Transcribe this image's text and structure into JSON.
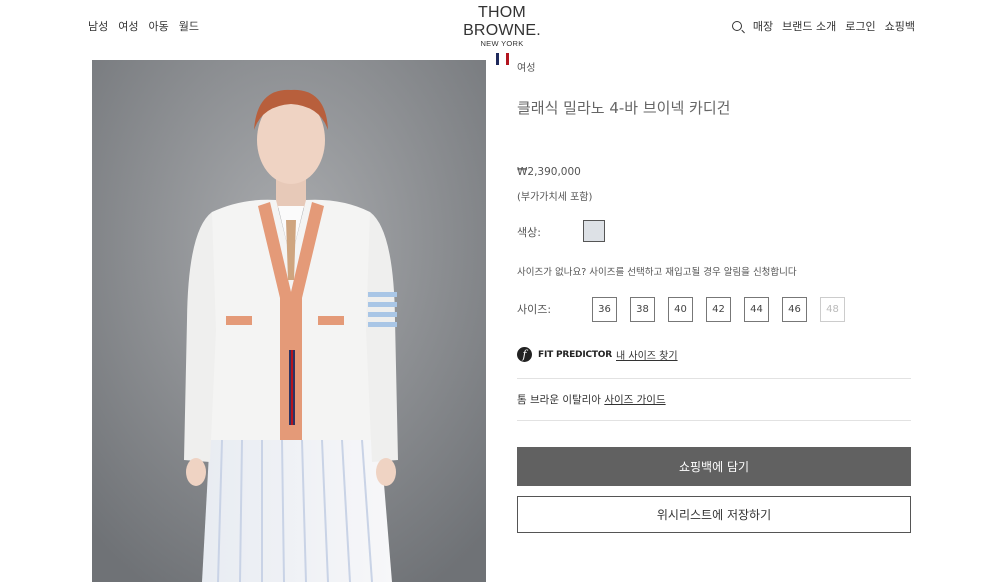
{
  "header": {
    "nav_left": [
      "남성",
      "여성",
      "아동",
      "월드"
    ],
    "brand": "THOM BROWNE.",
    "city": "NEW YORK",
    "flag_colors": [
      "#1f2a5c",
      "#ffffff",
      "#b3151f"
    ],
    "nav_right": [
      "매장",
      "브랜드 소개",
      "로그인",
      "쇼핑백"
    ]
  },
  "product": {
    "breadcrumb": "여성",
    "title": "클래식 밀라노 4-바 브이넥 카디건",
    "price": "₩2,390,000",
    "vat_note": "(부가가치세 포함)",
    "color_label": "색상:",
    "color_swatch": "#dde1e6",
    "notify_text": "사이즈가 없나요? 사이즈를 선택하고 재입고될 경우 알림을 신청합니다",
    "size_label": "사이즈:",
    "sizes": [
      {
        "label": "36",
        "available": true
      },
      {
        "label": "38",
        "available": true
      },
      {
        "label": "40",
        "available": true
      },
      {
        "label": "42",
        "available": true
      },
      {
        "label": "44",
        "available": true
      },
      {
        "label": "46",
        "available": true
      },
      {
        "label": "48",
        "available": false
      }
    ],
    "fit_predictor": {
      "name": "FIT PREDICTOR",
      "link": "내 사이즈 찾기"
    },
    "size_guide": {
      "text": "톰 브라운 이탈리아",
      "link": "사이즈 가이드"
    },
    "add_to_cart": "쇼핑백에 담기",
    "add_to_wishlist": "위시리스트에 저장하기"
  }
}
